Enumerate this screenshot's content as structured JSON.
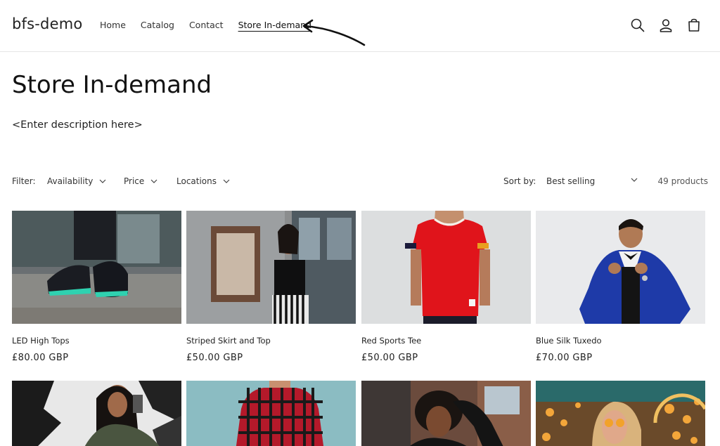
{
  "header": {
    "logo": "bfs-demo",
    "nav": [
      "Home",
      "Catalog",
      "Contact",
      "Store In-demand"
    ],
    "icons": [
      "search-icon",
      "account-icon",
      "cart-icon"
    ]
  },
  "page": {
    "title": "Store In-demand",
    "description": "<Enter description here>"
  },
  "filters": {
    "label": "Filter:",
    "items": [
      "Availability",
      "Price",
      "Locations"
    ],
    "sort_label": "Sort by:",
    "sort_value": "Best selling",
    "count": "49 products"
  },
  "products": [
    {
      "title": "LED High Tops",
      "price": "£80.00 GBP"
    },
    {
      "title": "Striped Skirt and Top",
      "price": "£50.00 GBP"
    },
    {
      "title": "Red Sports Tee",
      "price": "£50.00 GBP"
    },
    {
      "title": "Blue Silk Tuxedo",
      "price": "£70.00 GBP"
    }
  ],
  "colors": {
    "accent_text": "#121212",
    "border": "#e6e6e6"
  }
}
